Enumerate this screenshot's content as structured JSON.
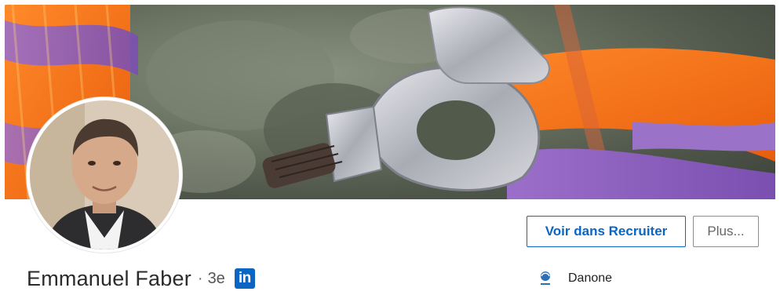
{
  "profile": {
    "name": "Emmanuel Faber",
    "separator": "·",
    "degree": "3e",
    "network_badge": "in",
    "company": "Danone"
  },
  "actions": {
    "recruiter_label": "Voir dans Recruiter",
    "more_label": "Plus..."
  },
  "icons": {
    "network": "linkedin-icon",
    "company_logo": "danone-logo"
  },
  "colors": {
    "brand": "#0a66c2",
    "text": "#2b2b2b",
    "muted": "#666666"
  }
}
